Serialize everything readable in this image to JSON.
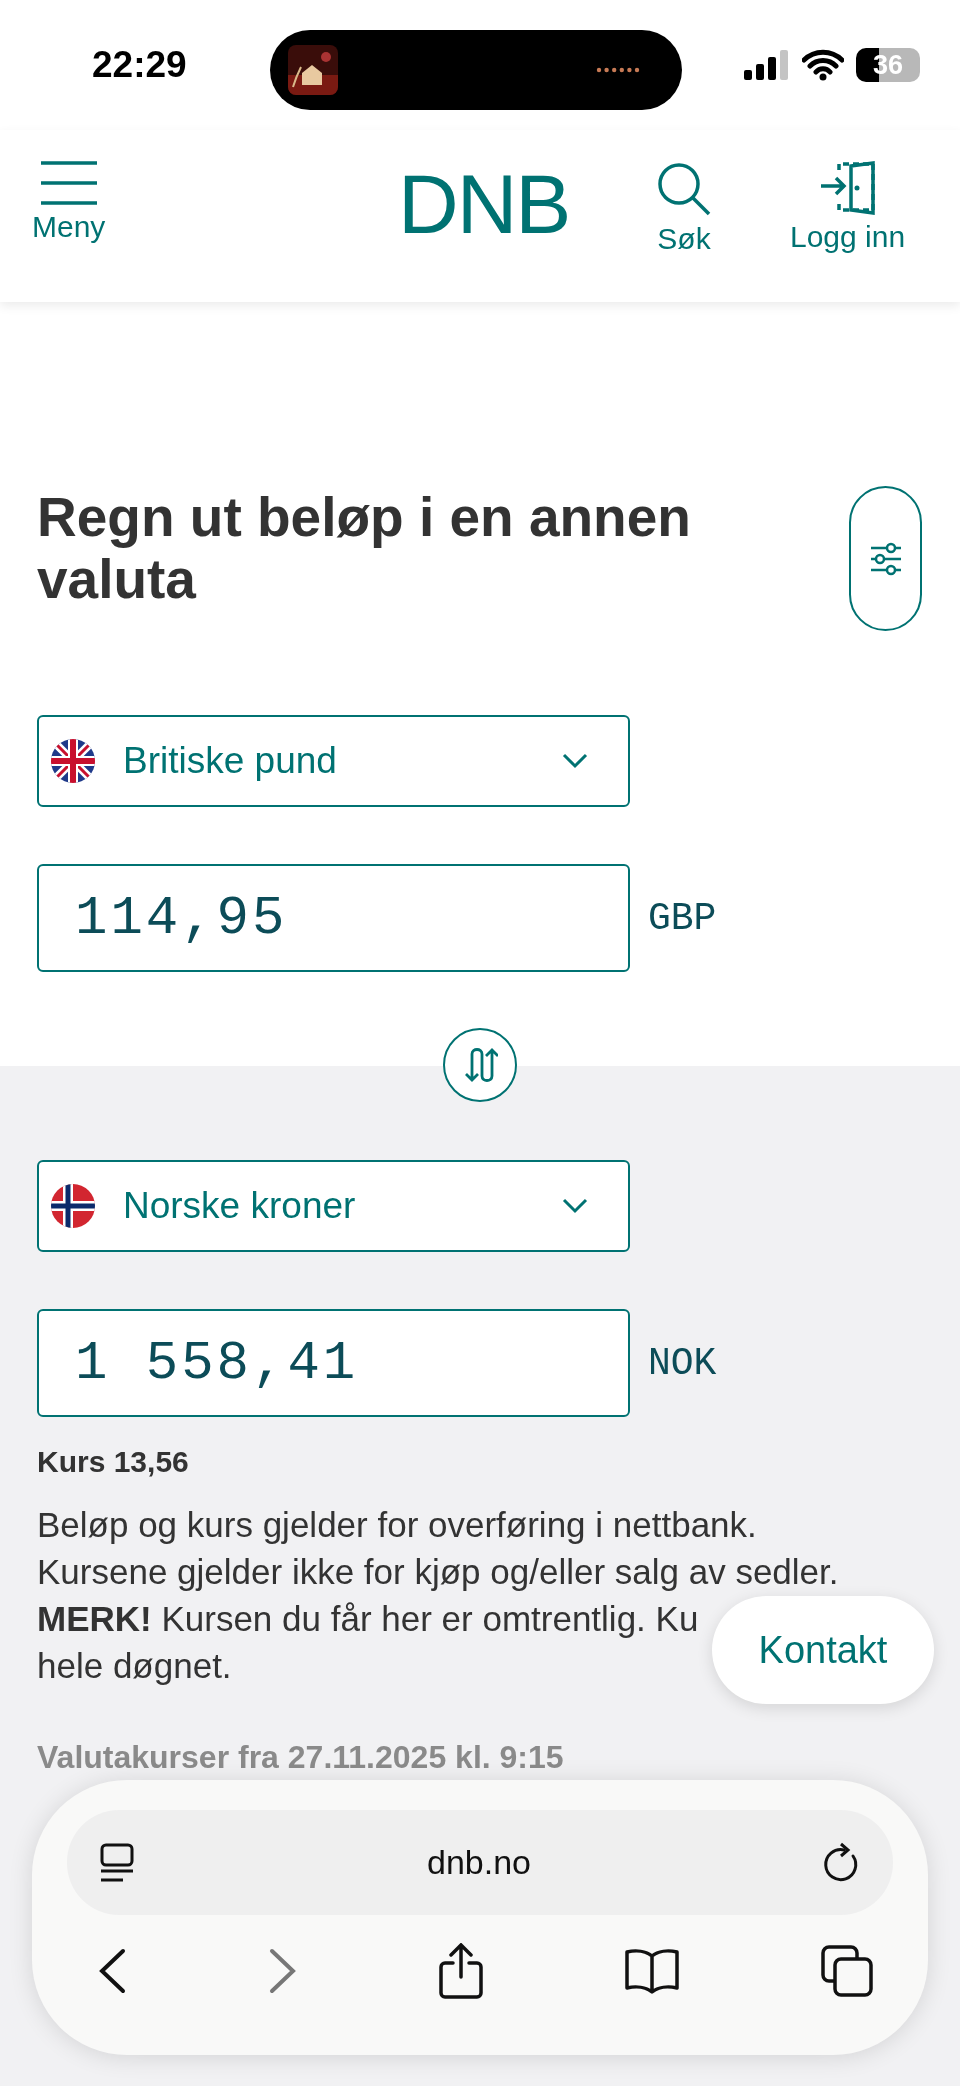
{
  "status_bar": {
    "time": "22:29",
    "battery": "36"
  },
  "header": {
    "menu_label": "Meny",
    "logo": "DNB",
    "search_label": "Søk",
    "login_label": "Logg inn"
  },
  "calculator": {
    "heading": "Regn ut beløp i en annen valuta",
    "from": {
      "kind": "gb",
      "currency_name": "Britiske pund",
      "amount": "114,95",
      "code": "GBP"
    },
    "to": {
      "kind": "no",
      "currency_name": "Norske kroner",
      "amount": "1 558,41",
      "code": "NOK"
    },
    "rate": "Kurs 13,56",
    "note_lines": [
      "Beløp og kurs gjelder for overføring i nettbank.",
      "Kursene gjelder ikke for kjøp og/eller salg av sedler.",
      "**MERK!** Kursen du får her er omtrentlig. Ku",
      "hele døgnet."
    ],
    "rates_date": "Valutakurser fra 27.11.2025 kl. 9:15"
  },
  "contact_button": "Kontakt",
  "browser": {
    "url": "dnb.no",
    "back_disabled": false,
    "forward_disabled": true
  }
}
